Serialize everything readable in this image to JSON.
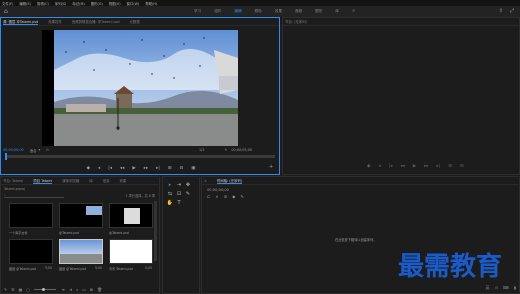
{
  "menubar": {
    "items": [
      "文件(F)",
      "编辑(E)",
      "剪辑(C)",
      "序列(S)",
      "标记(M)",
      "图形(G)",
      "视图(V)",
      "窗口(W)",
      "帮助(H)"
    ]
  },
  "workspace": {
    "tabs": [
      "学习",
      "组件",
      "编辑",
      "颜色",
      "效果",
      "音频",
      "图形",
      "库"
    ],
    "active_index": 2,
    "more": "»"
  },
  "source_panel": {
    "tabs": [
      "源: 图层 拿Tatami.psd",
      "效果控件",
      "音频剪辑混合器: 拿Tatami.psd",
      "元数据"
    ],
    "timecode_in": "00;00;00;00",
    "fit_label": "适合",
    "fraction": "1/2",
    "timecode_out": "00;00;05;00",
    "controls": [
      "◆",
      "◂",
      "|◂",
      "◂◂",
      "▶",
      "▸▸",
      "▸|",
      "⊞",
      "⊟",
      "▣"
    ]
  },
  "program_panel": {
    "tabs": [
      "节目: (无序列)"
    ],
    "controls": [
      "◆",
      "◂",
      "|◂",
      "◂◂",
      "▶",
      "▸▸",
      "▸|",
      "⊞",
      "⊟"
    ]
  },
  "project_panel": {
    "tabs": [
      "节目: Tatami",
      "项目 Tatami",
      "媒体浏览器",
      "库",
      "信息",
      "效果"
    ],
    "path": "Tatami.prproj",
    "count": "1 项已选择，共 6 项",
    "items": [
      {
        "label": "一个离字文件",
        "dur": "",
        "kind": "black"
      },
      {
        "label": "拿Tatami.psd",
        "dur": "",
        "kind": "photo-small"
      },
      {
        "label": "拿Tatami.psd",
        "dur": "",
        "kind": "photo-small"
      },
      {
        "label": "图层 拿Tatami.psd",
        "dur": "5;00",
        "kind": "black"
      },
      {
        "label": "图层 拿Tatami.psd",
        "dur": "5;00",
        "kind": "photo"
      },
      {
        "label": "背景 Tatami.psd",
        "dur": "5;00",
        "kind": "white"
      }
    ]
  },
  "tools": [
    "▸",
    "⇥",
    "✥",
    "⇆",
    "⊡",
    "✎",
    "✋",
    "T"
  ],
  "timeline_panel": {
    "tabs": [
      "时间轴: (无序列)"
    ],
    "timecode": "00;00;00;00",
    "message": "在此处放下媒体以创建序列。"
  },
  "watermark": "最需教育",
  "taskbar": [
    "英",
    "⊙",
    "⌨",
    "▮"
  ]
}
